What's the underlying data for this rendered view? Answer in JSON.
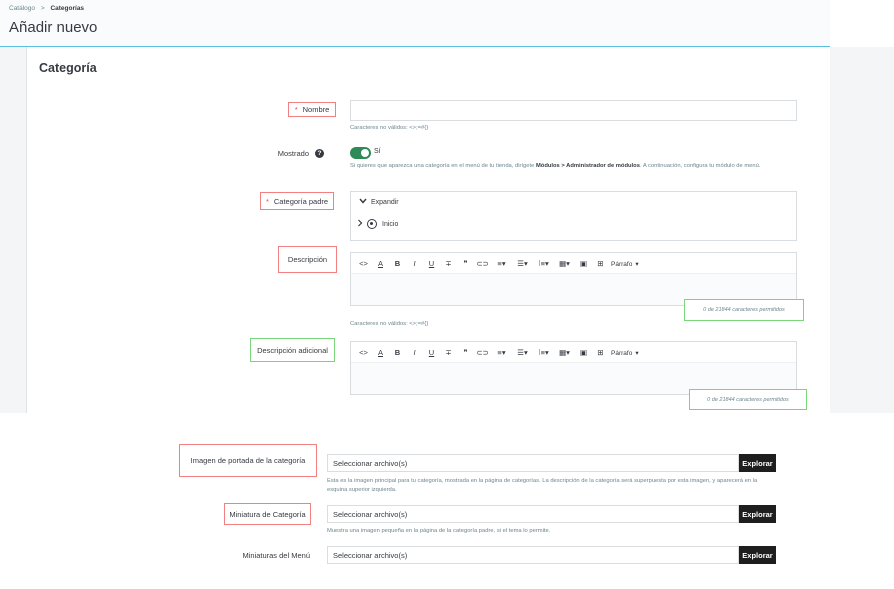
{
  "breadcrumb": {
    "parent": "Catálogo",
    "separator": ">",
    "current": "Categorías"
  },
  "page": {
    "title": "Añadir nuevo"
  },
  "card": {
    "title": "Categoría"
  },
  "fields": {
    "name": {
      "required_mark": "*",
      "label": "Nombre",
      "value": "",
      "help": "Caracteres no válidos: <>;=#{}"
    },
    "displayed": {
      "label": "Mostrado",
      "help_icon": "?",
      "toggle_value": "Sí",
      "help_part1": "Si quieres que aparezca una categoría en el menú de tu tienda, dirígete ",
      "help_bold": "Módulos > Administrador de módulos",
      "help_part2": ". A continuación, configura tu módulo de menú."
    },
    "parent": {
      "required_mark": "*",
      "label": "Categoría padre",
      "expand_label": "Expandir",
      "root_label": "Inicio"
    },
    "description": {
      "label": "Descripción",
      "counter": "0 de 21844 caracteres permitidos",
      "help": "Caracteres no válidos: <>;=#{}"
    },
    "additional_description": {
      "label": "Descripción adicional",
      "counter": "0 de 21844 caracteres permitidos"
    },
    "cover_image": {
      "label": "Imagen de portada de la categoría",
      "placeholder": "Seleccionar archivo(s)",
      "button": "Explorar",
      "help": "Esta es la imagen principal para tu categoría, mostrada en la página de categorías. La descripción de la categoría será superpuesta por esta imagen, y aparecerá en la esquina superior izquierda."
    },
    "thumbnail": {
      "label": "Miniatura de Categoría",
      "placeholder": "Seleccionar archivo(s)",
      "button": "Explorar",
      "help": "Muestra una imagen pequeña en la página de la categoría padre, si el tema lo permite."
    },
    "menu_thumbnails": {
      "label": "Miniaturas del Menú",
      "placeholder": "Seleccionar archivo(s)",
      "button": "Explorar"
    }
  },
  "toolbar": {
    "code": "<>",
    "font_color": "A",
    "bold": "B",
    "italic": "I",
    "underline": "U",
    "strikethrough": "∓",
    "quote": "❞",
    "link": "⊂⊃",
    "align": "≡",
    "bullets": "☰",
    "numbers": "⁝≡",
    "table": "▦",
    "image": "▣",
    "media": "⊞",
    "paragraph": "Párrafo",
    "dropdown": "▾"
  },
  "icons": {
    "chevron_down": "chevron-down-icon",
    "chevron_right": "chevron-right-icon",
    "help": "question-circle-icon",
    "radio": "radio-selected-icon"
  },
  "colors": {
    "accent": "#5bc0de",
    "toggle_on": "#2e8b57",
    "required": "#e0483f",
    "red_outline": "#f28080",
    "green_outline": "#7bd67b",
    "dark_button": "#1e1e1e"
  }
}
